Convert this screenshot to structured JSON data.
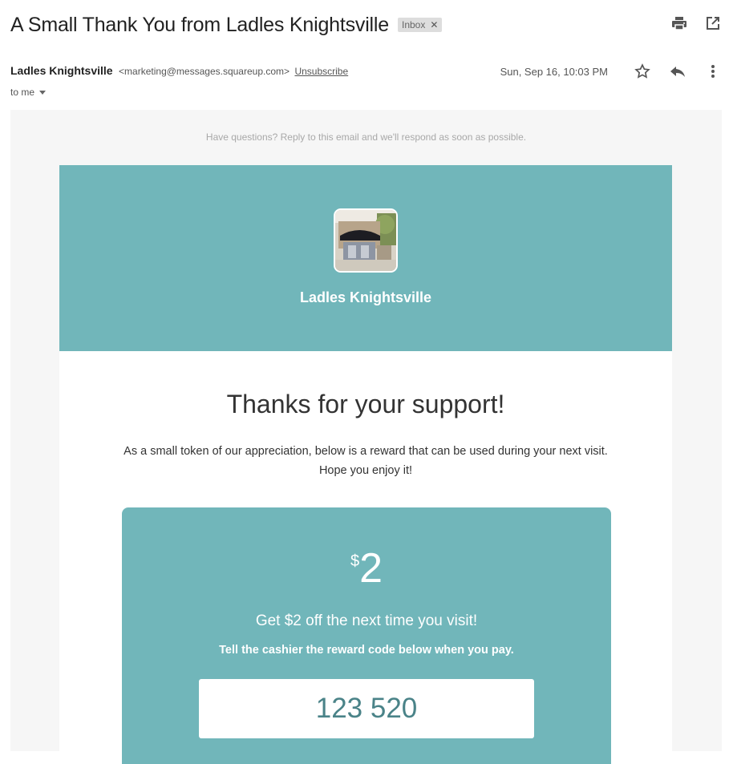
{
  "email": {
    "subject": "A Small Thank You from Ladles Knightsville",
    "label": "Inbox",
    "sender_name": "Ladles Knightsville",
    "sender_email": "<marketing@messages.squareup.com>",
    "unsubscribe": "Unsubscribe",
    "date": "Sun, Sep 16, 10:03 PM",
    "recipient": "to me"
  },
  "body": {
    "preheader": "Have questions? Reply to this email and we'll respond as soon as possible.",
    "business_name": "Ladles Knightsville",
    "headline": "Thanks for your support!",
    "message": "As a small token of our appreciation, below is a reward that can be used during your next visit. Hope you enjoy it!",
    "reward": {
      "currency": "$",
      "amount": "2",
      "offer": "Get $2 off the next time you visit!",
      "instruction": "Tell the cashier the reward code below when you pay.",
      "code": "123 520"
    }
  },
  "icons": {
    "print": "print-icon",
    "open_new_window": "open-in-new-window-icon",
    "star": "star-icon",
    "reply": "reply-icon",
    "more": "more-vertical-icon",
    "remove_label": "close-icon",
    "expand_details": "caret-down-icon"
  },
  "colors": {
    "teal": "#71b6ba",
    "code_text": "#4a8388"
  }
}
